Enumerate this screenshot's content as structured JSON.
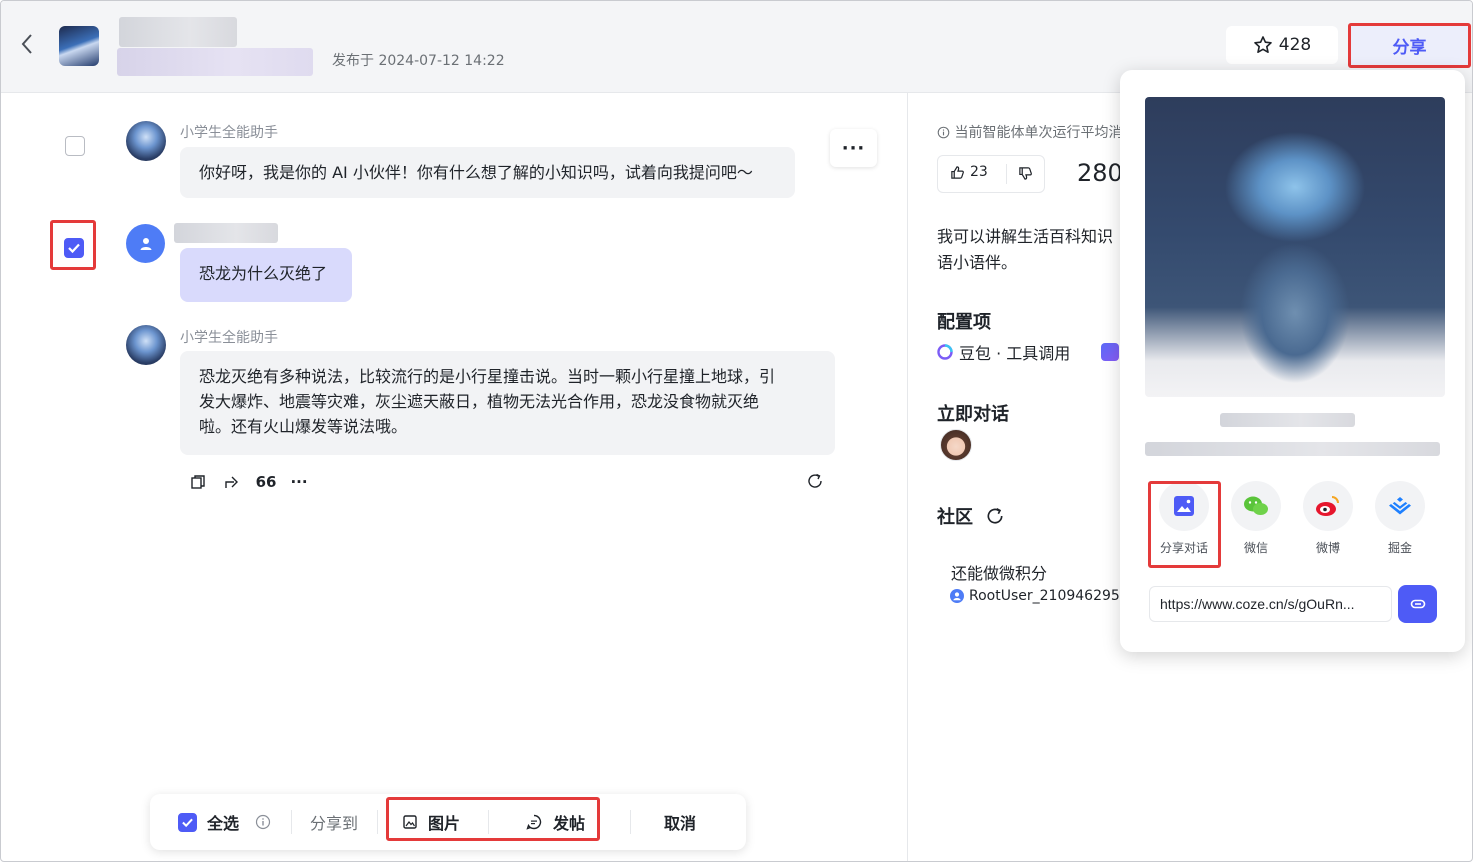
{
  "header": {
    "publish_time": "发布于 2024-07-12 14:22",
    "star_count": "428",
    "share_label": "分享"
  },
  "chat": {
    "messages": [
      {
        "sender": "小学生全能助手",
        "text": "你好呀，我是你的 AI 小伙伴！你有什么想了解的小知识吗，试着向我提问吧～"
      },
      {
        "sender": "",
        "text": "恐龙为什么灭绝了"
      },
      {
        "sender": "小学生全能助手",
        "lines": [
          "恐龙灭绝有多种说法，比较流行的是小行星撞击说。当时一颗小行星撞上地球，引",
          "发大爆炸、地震等灾难，灰尘遮天蔽日，植物无法光合作用，恐龙没食物就灭绝",
          "啦。还有火山爆发等说法哦。"
        ]
      }
    ],
    "more_label": "···",
    "actions": {
      "quote_label": "66",
      "more_label": "···"
    }
  },
  "toolbar": {
    "select_all": "全选",
    "share_to": "分享到",
    "image": "图片",
    "post": "发帖",
    "cancel": "取消"
  },
  "panel": {
    "avg_note": "当前智能体单次运行平均消",
    "like_count": "23",
    "stat_value": "280",
    "desc_lines": [
      "我可以讲解生活百科知识",
      "语小语伴。"
    ],
    "config_title": "配置项",
    "config_item": "豆包 · 工具调用",
    "chat_title": "立即对话",
    "community_title": "社区",
    "post_title": "还能做微积分",
    "post_author": "RootUser_2109462951"
  },
  "share_popover": {
    "options": [
      {
        "label": "分享对话",
        "icon": "image-icon"
      },
      {
        "label": "微信",
        "icon": "wechat-icon"
      },
      {
        "label": "微博",
        "icon": "weibo-icon"
      },
      {
        "label": "掘金",
        "icon": "juejin-icon"
      }
    ],
    "link": "https://www.coze.cn/s/gOuRn..."
  },
  "colors": {
    "accent": "#4e5bf6",
    "highlight": "#e43a3a"
  }
}
